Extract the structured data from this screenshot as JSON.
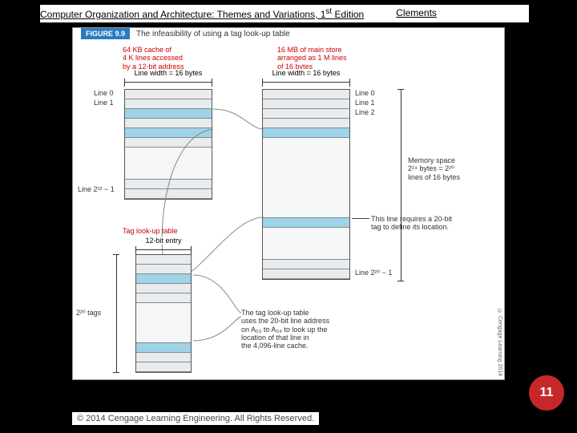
{
  "header": {
    "title_pre": "Computer Organization and Architecture: Themes and Variations, 1",
    "title_sup": "st",
    "title_post": " Edition",
    "author": "Clements"
  },
  "figure": {
    "badge": "FIGURE 9.9",
    "caption": "The infeasibility of using a tag look-up table",
    "cache_desc_1": "64 KB cache of",
    "cache_desc_2": "4 K lines accessed",
    "cache_desc_3": "by a 12-bit address",
    "main_desc_1": "16 MB of main store",
    "main_desc_2": "arranged as 1 M lines",
    "main_desc_3": "of 16 bytes",
    "line_width_left": "Line width = 16 bytes",
    "line_width_right": "Line width = 16 bytes",
    "cache_line0": "Line 0",
    "cache_line1": "Line 1",
    "cache_last": "Line 2¹² − 1",
    "main_line0": "Line 0",
    "main_line1": "Line 1",
    "main_line2": "Line 2",
    "main_last": "Line 2²⁰ − 1",
    "mem_space_1": "Memory space",
    "mem_space_2": "2²⁴ bytes = 2²⁰",
    "mem_space_3": "lines of 16 bytes",
    "tag_req_1": "This line requires a 20-bit",
    "tag_req_2": "tag to define its location.",
    "lookup_label": "Tag look-up table",
    "entry_width": "12-bit entry",
    "tags_count": "2²⁰ tags",
    "note_1": "The tag look-up table",
    "note_2": "uses the 20-bit line address",
    "note_3": "on A₀₃ to A₀₄ to look up the",
    "note_4": "location of that line in",
    "note_5": "the 4,096-line cache.",
    "copyright_side": "© Cengage Learning 2014"
  },
  "page_number": "11",
  "footer": "© 2014 Cengage Learning Engineering. All Rights Reserved."
}
